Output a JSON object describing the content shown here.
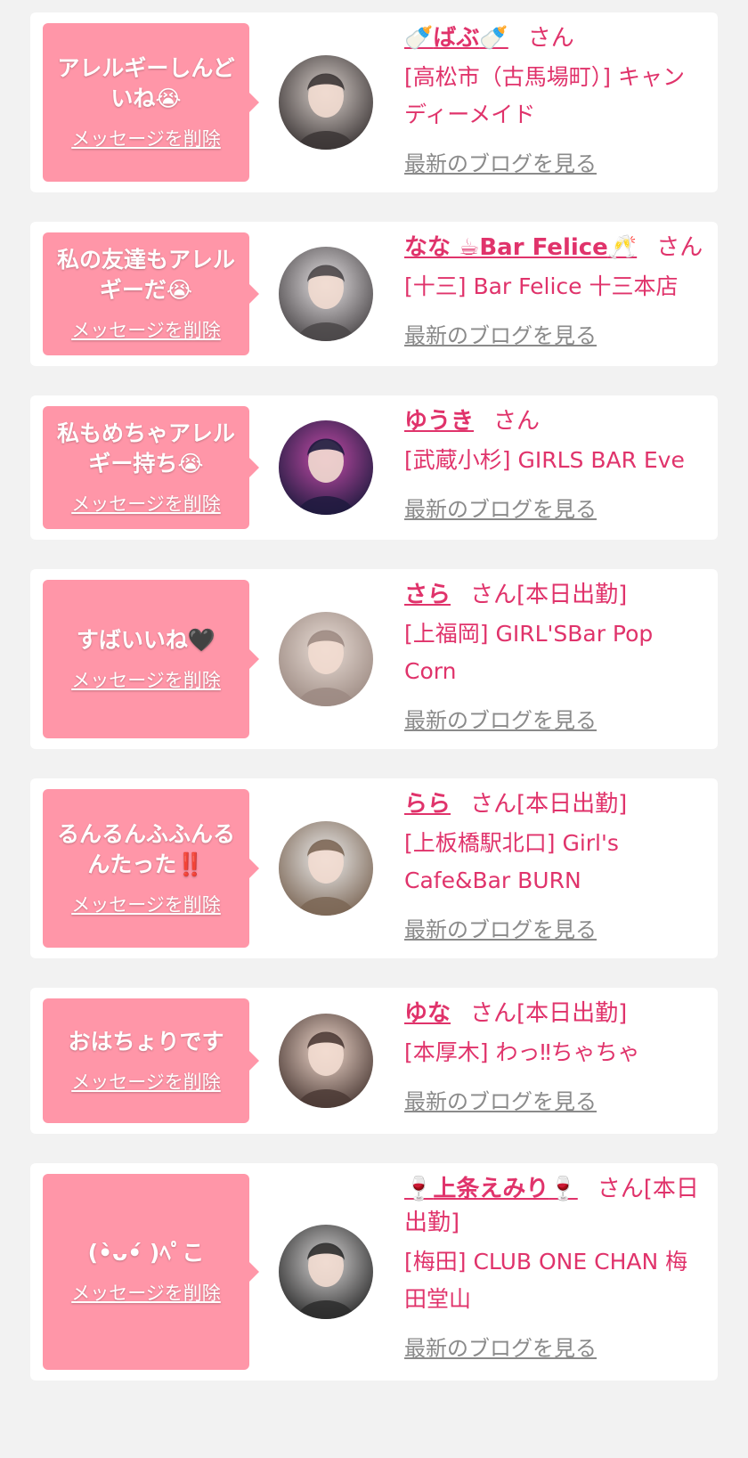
{
  "delete_label": "メッセージを削除",
  "blog_label": "最新のブログを見る",
  "san_suffix": "さん",
  "colors": {
    "background": "#f2f2f2",
    "card": "#ffffff",
    "bubble": "#ff96a8",
    "name": "#e0336b",
    "link_gray": "#8a8a8a"
  },
  "messages": [
    {
      "message": "アレルギーしんどいね😭",
      "name_prefix": "🍼",
      "name": "ばぶ",
      "name_suffix": "🍼",
      "san_text": "さん",
      "shop": "[高松市（古馬場町）] キャンディーメイド",
      "avatar_icon": "avatar-photo-icon"
    },
    {
      "message": "私の友達もアレルギーだ😭",
      "name_prefix": "",
      "name": "なな ☕Bar Felice",
      "name_suffix": "🥂",
      "san_text": "さん",
      "shop": "[十三] Bar Felice 十三本店",
      "avatar_icon": "avatar-photo-icon"
    },
    {
      "message": "私もめちゃアレルギー持ち😭",
      "name_prefix": "",
      "name": "ゆうき",
      "name_suffix": "",
      "san_text": "さん",
      "shop": "[武蔵小杉] GIRLS BAR Eve",
      "avatar_icon": "avatar-photo-icon"
    },
    {
      "message": "すばいいね🖤",
      "name_prefix": "",
      "name": "さら",
      "name_suffix": "",
      "san_text": "さん[本日出勤]",
      "shop": "[上福岡] GIRL'SBar Pop Corn",
      "avatar_icon": "avatar-photo-icon"
    },
    {
      "message": "るんるんふふんるんたった‼️",
      "name_prefix": "",
      "name": "らら",
      "name_suffix": "",
      "san_text": "さん[本日出勤]",
      "shop": "[上板橋駅北口] Girl's Cafe&Bar BURN",
      "avatar_icon": "avatar-photo-icon"
    },
    {
      "message": "おはちょりです",
      "name_prefix": "",
      "name": "ゆな",
      "name_suffix": "",
      "san_text": "さん[本日出勤]",
      "shop": "[本厚木] わっ‼ちゃちゃ",
      "avatar_icon": "avatar-photo-icon"
    },
    {
      "message": "(•̀ᴗ•́ )ﾍﾟこ",
      "name_prefix": "🍷",
      "name": "上条えみり",
      "name_suffix": "🍷",
      "san_text": "さん[本日出勤]",
      "shop": "[梅田] CLUB ONE CHAN 梅田堂山",
      "avatar_icon": "avatar-photo-icon"
    }
  ]
}
